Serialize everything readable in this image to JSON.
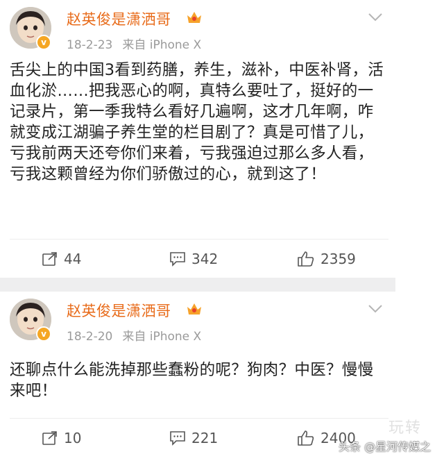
{
  "posts": [
    {
      "username": "赵英俊是潇洒哥",
      "date": "18-2-23",
      "source": "来自 iPhone X",
      "text": "舌尖上的中国3看到药膳，养生，滋补，中医补肾，活血化淤……把我恶心的啊，真特么要吐了，挺好的一记录片，第一季我特么看好几遍啊，这才几年啊，咋就变成江湖骗子养生堂的栏目剧了？真是可惜了儿，亏我前两天还夸你们来着，亏我强迫过那么多人看，亏我这颗曾经为你们骄傲过的心，就到这了！",
      "reposts": "44",
      "comments": "342",
      "likes": "2359"
    },
    {
      "username": "赵英俊是潇洒哥",
      "date": "18-2-20",
      "source": "来自 iPhone X",
      "text": "还聊点什么能洗掉那些蠢粉的呢？狗肉？中医？慢慢来吧！",
      "reposts": "10",
      "comments": "221",
      "likes": "2400"
    }
  ],
  "watermark": {
    "attribution": "头条 @星河传媒之",
    "faint": "玩转"
  },
  "colors": {
    "username": "#e86b1a",
    "meta": "#9a9a9a",
    "text": "#222222",
    "separator": "#eeeeef",
    "verified_badge": "#f5a623"
  },
  "icons": {
    "repost": "repost-icon",
    "comment": "comment-icon",
    "like": "like-icon",
    "menu": "chevron-down-icon",
    "vip": "vip-crown-icon",
    "verified": "verified-badge-icon"
  }
}
